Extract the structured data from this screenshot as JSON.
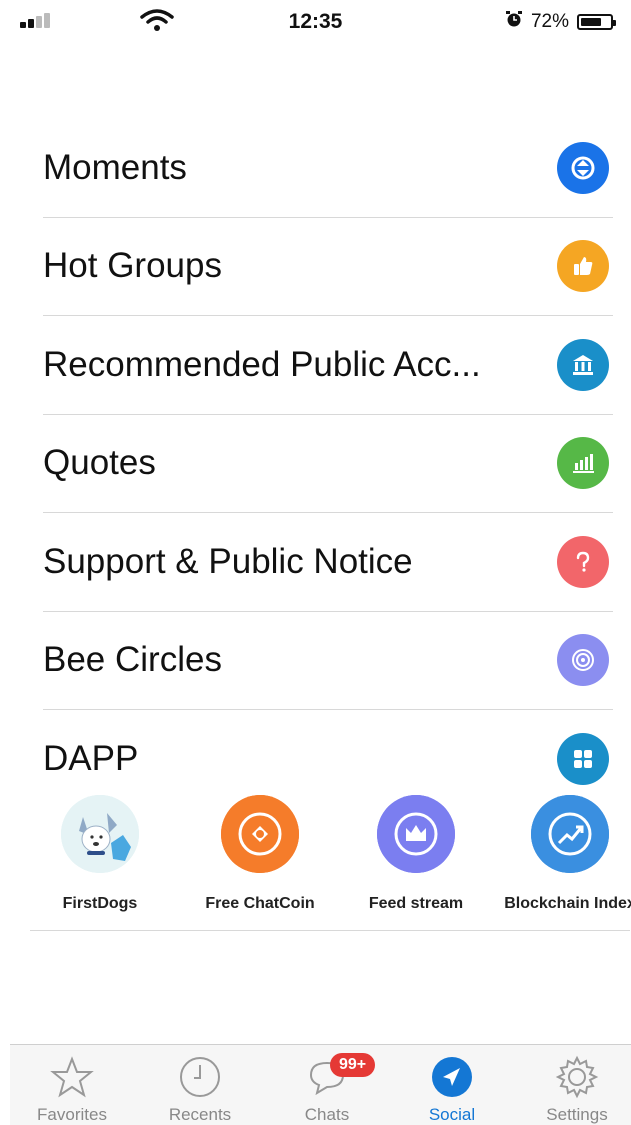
{
  "status_bar": {
    "time": "12:35",
    "battery": "72%",
    "battery_level": 0.72
  },
  "menu": {
    "items": [
      {
        "label": "Moments",
        "icon": "moments-icon",
        "color": "#1a73e8"
      },
      {
        "label": "Hot Groups",
        "icon": "thumbs-up-icon",
        "color": "#f5a623"
      },
      {
        "label": "Recommended Public Acc...",
        "icon": "bank-icon",
        "color": "#1a8fc9"
      },
      {
        "label": "Quotes",
        "icon": "bar-chart-icon",
        "color": "#56b847"
      },
      {
        "label": "Support & Public Notice",
        "icon": "question-icon",
        "color": "#f2666a"
      },
      {
        "label": "Bee Circles",
        "icon": "target-icon",
        "color": "#8b8ef0"
      },
      {
        "label": "DAPP",
        "icon": "grid-icon",
        "color": "#1a8fc9"
      }
    ]
  },
  "dapps": [
    {
      "label": "FirstDogs",
      "icon": "dog-icon"
    },
    {
      "label": "Free ChatCoin",
      "icon": "coin-icon",
      "color": "#f57c2a"
    },
    {
      "label": "Feed stream",
      "icon": "crown-icon",
      "color": "#7b7ef0"
    },
    {
      "label": "Blockchain Index",
      "icon": "trend-icon",
      "color": "#3a8fe0"
    }
  ],
  "tabbar": {
    "tabs": [
      {
        "label": "Favorites",
        "icon": "star-icon"
      },
      {
        "label": "Recents",
        "icon": "clock-icon"
      },
      {
        "label": "Chats",
        "icon": "chat-icon",
        "badge": "99+"
      },
      {
        "label": "Social",
        "icon": "compass-icon",
        "active": true
      },
      {
        "label": "Settings",
        "icon": "gear-icon"
      }
    ]
  }
}
